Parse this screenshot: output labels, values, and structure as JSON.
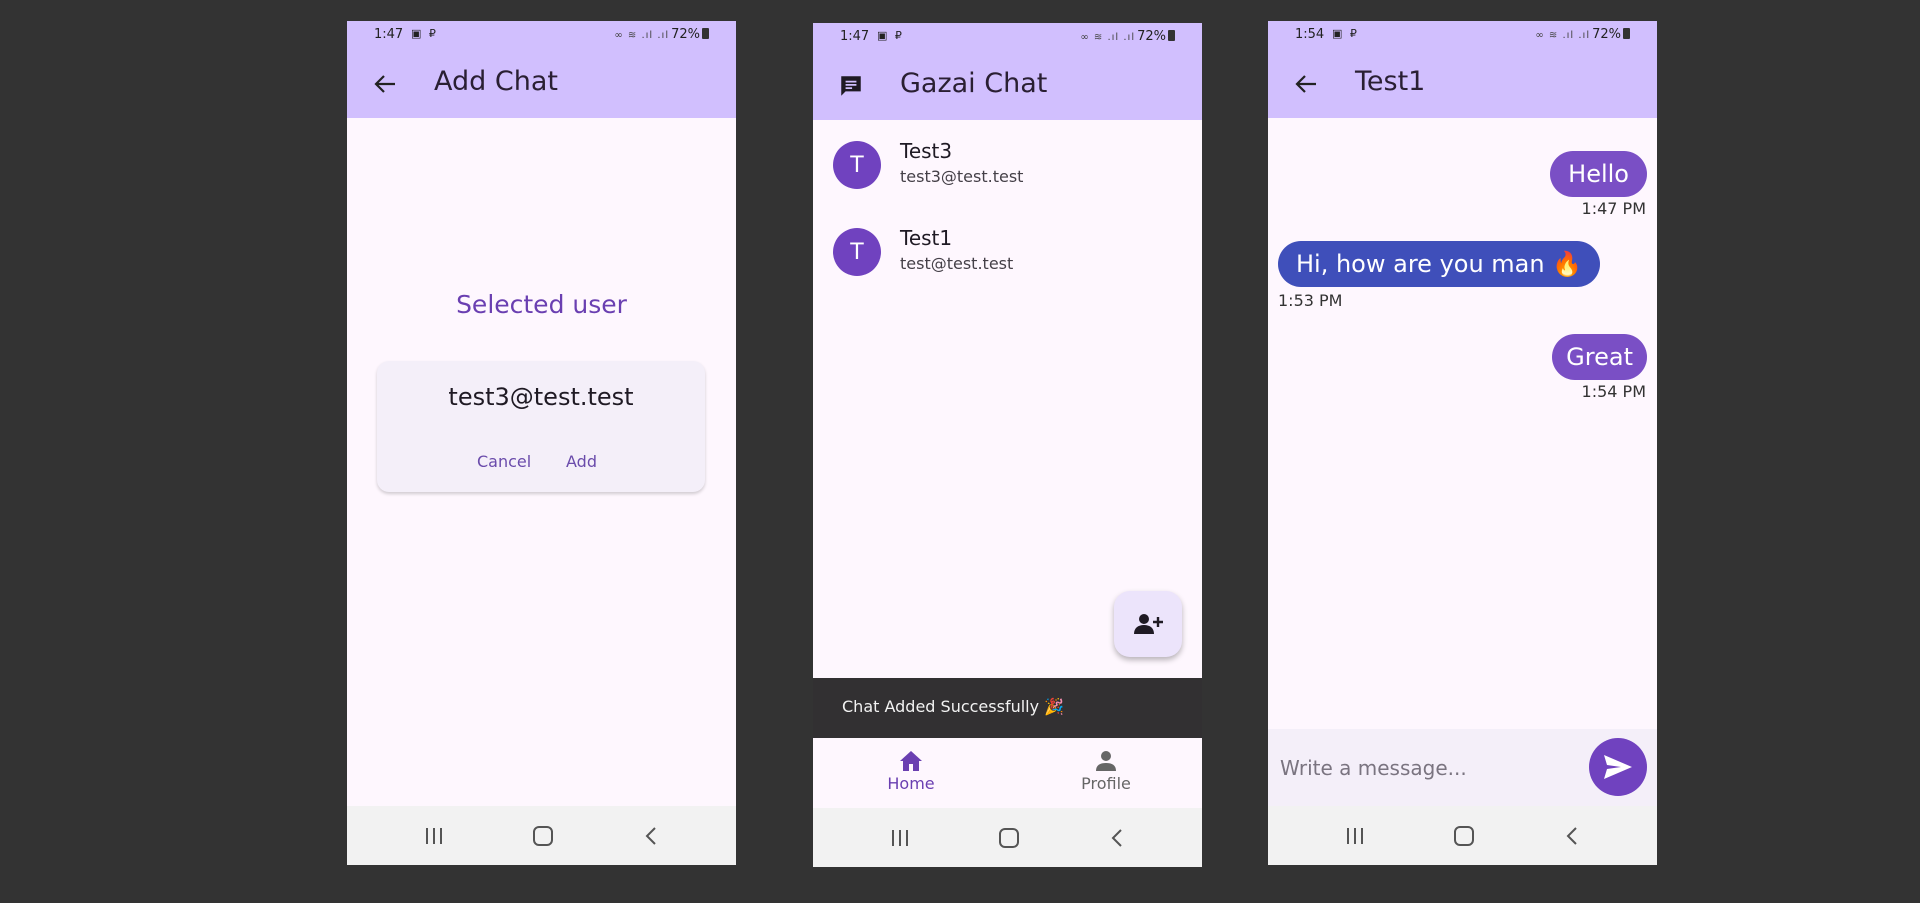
{
  "theme": {
    "appbar": "#d1bffe",
    "accent": "#7042bf",
    "received_bubble": "#3f4fba",
    "background": "#333333"
  },
  "screen1": {
    "status": {
      "time": "1:47",
      "battery": "72%"
    },
    "title": "Add Chat",
    "back_icon": "arrow-left-icon",
    "selected_label": "Selected user",
    "selected_email": "test3@test.test",
    "cancel_label": "Cancel",
    "add_label": "Add"
  },
  "screen2": {
    "status": {
      "time": "1:47",
      "battery": "72%"
    },
    "title": "Gazai Chat",
    "chats": [
      {
        "initial": "T",
        "name": "Test3",
        "email": "test3@test.test"
      },
      {
        "initial": "T",
        "name": "Test1",
        "email": "test@test.test"
      }
    ],
    "fab_icon": "person-add-icon",
    "snackbar": "Chat Added Successfully 🎉",
    "nav": {
      "home": "Home",
      "profile": "Profile"
    }
  },
  "screen3": {
    "status": {
      "time": "1:54",
      "battery": "72%"
    },
    "title": "Test1",
    "messages": [
      {
        "text": "Hello",
        "time": "1:47 PM",
        "sent": true
      },
      {
        "text": "Hi, how are you man 🔥",
        "time": "1:53 PM",
        "sent": false
      },
      {
        "text": "Great",
        "time": "1:54 PM",
        "sent": true
      }
    ],
    "input_placeholder": "Write a message...",
    "send_icon": "send-icon"
  }
}
